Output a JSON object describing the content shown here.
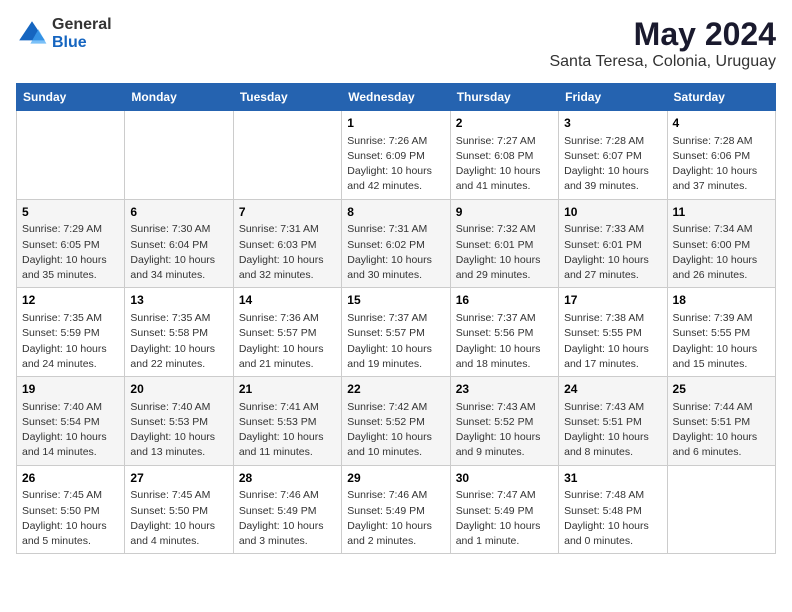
{
  "logo": {
    "general": "General",
    "blue": "Blue"
  },
  "title": "May 2024",
  "subtitle": "Santa Teresa, Colonia, Uruguay",
  "days_header": [
    "Sunday",
    "Monday",
    "Tuesday",
    "Wednesday",
    "Thursday",
    "Friday",
    "Saturday"
  ],
  "weeks": [
    [
      {
        "num": "",
        "info": ""
      },
      {
        "num": "",
        "info": ""
      },
      {
        "num": "",
        "info": ""
      },
      {
        "num": "1",
        "info": "Sunrise: 7:26 AM\nSunset: 6:09 PM\nDaylight: 10 hours\nand 42 minutes."
      },
      {
        "num": "2",
        "info": "Sunrise: 7:27 AM\nSunset: 6:08 PM\nDaylight: 10 hours\nand 41 minutes."
      },
      {
        "num": "3",
        "info": "Sunrise: 7:28 AM\nSunset: 6:07 PM\nDaylight: 10 hours\nand 39 minutes."
      },
      {
        "num": "4",
        "info": "Sunrise: 7:28 AM\nSunset: 6:06 PM\nDaylight: 10 hours\nand 37 minutes."
      }
    ],
    [
      {
        "num": "5",
        "info": "Sunrise: 7:29 AM\nSunset: 6:05 PM\nDaylight: 10 hours\nand 35 minutes."
      },
      {
        "num": "6",
        "info": "Sunrise: 7:30 AM\nSunset: 6:04 PM\nDaylight: 10 hours\nand 34 minutes."
      },
      {
        "num": "7",
        "info": "Sunrise: 7:31 AM\nSunset: 6:03 PM\nDaylight: 10 hours\nand 32 minutes."
      },
      {
        "num": "8",
        "info": "Sunrise: 7:31 AM\nSunset: 6:02 PM\nDaylight: 10 hours\nand 30 minutes."
      },
      {
        "num": "9",
        "info": "Sunrise: 7:32 AM\nSunset: 6:01 PM\nDaylight: 10 hours\nand 29 minutes."
      },
      {
        "num": "10",
        "info": "Sunrise: 7:33 AM\nSunset: 6:01 PM\nDaylight: 10 hours\nand 27 minutes."
      },
      {
        "num": "11",
        "info": "Sunrise: 7:34 AM\nSunset: 6:00 PM\nDaylight: 10 hours\nand 26 minutes."
      }
    ],
    [
      {
        "num": "12",
        "info": "Sunrise: 7:35 AM\nSunset: 5:59 PM\nDaylight: 10 hours\nand 24 minutes."
      },
      {
        "num": "13",
        "info": "Sunrise: 7:35 AM\nSunset: 5:58 PM\nDaylight: 10 hours\nand 22 minutes."
      },
      {
        "num": "14",
        "info": "Sunrise: 7:36 AM\nSunset: 5:57 PM\nDaylight: 10 hours\nand 21 minutes."
      },
      {
        "num": "15",
        "info": "Sunrise: 7:37 AM\nSunset: 5:57 PM\nDaylight: 10 hours\nand 19 minutes."
      },
      {
        "num": "16",
        "info": "Sunrise: 7:37 AM\nSunset: 5:56 PM\nDaylight: 10 hours\nand 18 minutes."
      },
      {
        "num": "17",
        "info": "Sunrise: 7:38 AM\nSunset: 5:55 PM\nDaylight: 10 hours\nand 17 minutes."
      },
      {
        "num": "18",
        "info": "Sunrise: 7:39 AM\nSunset: 5:55 PM\nDaylight: 10 hours\nand 15 minutes."
      }
    ],
    [
      {
        "num": "19",
        "info": "Sunrise: 7:40 AM\nSunset: 5:54 PM\nDaylight: 10 hours\nand 14 minutes."
      },
      {
        "num": "20",
        "info": "Sunrise: 7:40 AM\nSunset: 5:53 PM\nDaylight: 10 hours\nand 13 minutes."
      },
      {
        "num": "21",
        "info": "Sunrise: 7:41 AM\nSunset: 5:53 PM\nDaylight: 10 hours\nand 11 minutes."
      },
      {
        "num": "22",
        "info": "Sunrise: 7:42 AM\nSunset: 5:52 PM\nDaylight: 10 hours\nand 10 minutes."
      },
      {
        "num": "23",
        "info": "Sunrise: 7:43 AM\nSunset: 5:52 PM\nDaylight: 10 hours\nand 9 minutes."
      },
      {
        "num": "24",
        "info": "Sunrise: 7:43 AM\nSunset: 5:51 PM\nDaylight: 10 hours\nand 8 minutes."
      },
      {
        "num": "25",
        "info": "Sunrise: 7:44 AM\nSunset: 5:51 PM\nDaylight: 10 hours\nand 6 minutes."
      }
    ],
    [
      {
        "num": "26",
        "info": "Sunrise: 7:45 AM\nSunset: 5:50 PM\nDaylight: 10 hours\nand 5 minutes."
      },
      {
        "num": "27",
        "info": "Sunrise: 7:45 AM\nSunset: 5:50 PM\nDaylight: 10 hours\nand 4 minutes."
      },
      {
        "num": "28",
        "info": "Sunrise: 7:46 AM\nSunset: 5:49 PM\nDaylight: 10 hours\nand 3 minutes."
      },
      {
        "num": "29",
        "info": "Sunrise: 7:46 AM\nSunset: 5:49 PM\nDaylight: 10 hours\nand 2 minutes."
      },
      {
        "num": "30",
        "info": "Sunrise: 7:47 AM\nSunset: 5:49 PM\nDaylight: 10 hours\nand 1 minute."
      },
      {
        "num": "31",
        "info": "Sunrise: 7:48 AM\nSunset: 5:48 PM\nDaylight: 10 hours\nand 0 minutes."
      },
      {
        "num": "",
        "info": ""
      }
    ]
  ]
}
